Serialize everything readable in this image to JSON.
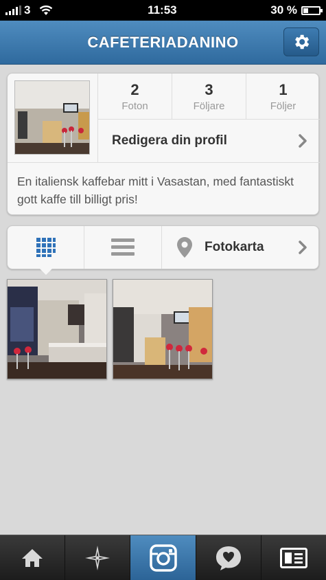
{
  "status_bar": {
    "carrier": "3",
    "time": "11:53",
    "battery": "30 %",
    "battery_level": 0.3
  },
  "header": {
    "title": "CAFETERIADANINO",
    "settings_icon": "gear-icon"
  },
  "profile": {
    "stats": [
      {
        "value": "2",
        "label": "Foton"
      },
      {
        "value": "3",
        "label": "Följare"
      },
      {
        "value": "1",
        "label": "Följer"
      }
    ],
    "edit_label": "Redigera din profil",
    "bio": "En italiensk kaffebar mitt i Vasastan, med fantastiskt gott kaffe till billigt pris!"
  },
  "view_tabs": {
    "grid_icon": "grid-icon",
    "list_icon": "list-icon",
    "map_icon": "location-pin-icon",
    "map_label": "Fotokarta"
  },
  "bottom_tabs": [
    {
      "icon": "home-icon",
      "active": false
    },
    {
      "icon": "explore-icon",
      "active": false
    },
    {
      "icon": "camera-icon",
      "active": true
    },
    {
      "icon": "activity-icon",
      "active": false
    },
    {
      "icon": "profile-icon",
      "active": false
    }
  ],
  "colors": {
    "accent": "#2f6a9e",
    "background": "#d9d9d9"
  }
}
